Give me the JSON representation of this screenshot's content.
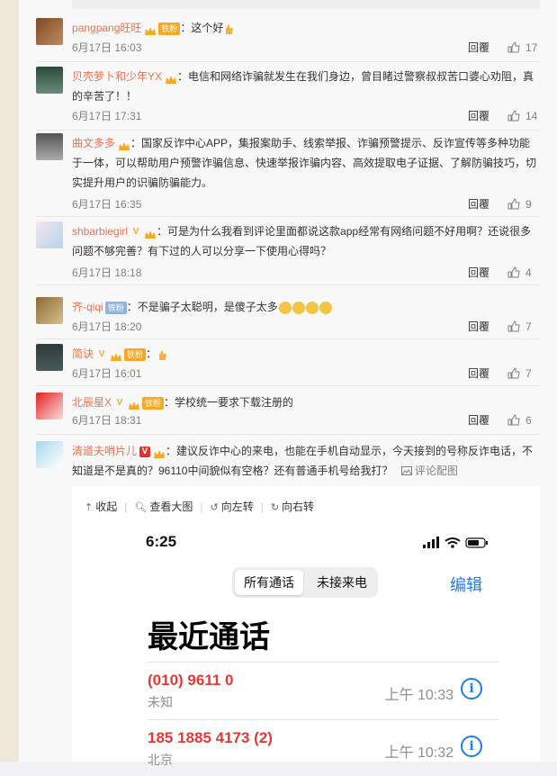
{
  "comments": [
    {
      "username": "pangpang旺旺",
      "badge": "铁粉",
      "content": "：这个好",
      "date": "6月17日 16:03",
      "reply_label": "回覆",
      "likes": "17"
    },
    {
      "username": "贝壳萝卜和少年YX",
      "badge": "",
      "content": "：电信和网络诈骗就发生在我们身边，曾目睹过警察叔叔苦口婆心劝阻，真的辛苦了！！",
      "date": "6月17日 17:31",
      "reply_label": "回覆",
      "likes": "14"
    },
    {
      "username": "曲文多多",
      "badge": "",
      "content": "：国家反诈中心APP，集报案助手、线索举报、诈骗预警提示、反诈宣传等多种功能于一体，可以帮助用户预警诈骗信息、快速举报诈骗内容、高效提取电子证据、了解防骗技巧，切实提升用户的识骗防骗能力。",
      "date": "6月17日 16:35",
      "reply_label": "回覆",
      "likes": "9"
    },
    {
      "username": "shbarbiegirl",
      "badge": "",
      "content": "：可是为什么我看到评论里面都说这款app经常有网络问题不好用啊？还说很多问题不够完善？有下过的人可以分享一下使用心得吗？",
      "date": "6月17日 18:18",
      "reply_label": "回覆",
      "likes": "4"
    },
    {
      "username": "齐-qiqi",
      "badge": "铁粉",
      "content": "：不是骗子太聪明，是傻子太多",
      "date": "6月17日 18:20",
      "reply_label": "回覆",
      "likes": "7"
    },
    {
      "username": "简诀",
      "badge": "铁粉",
      "content": "：",
      "date": "6月17日 16:01",
      "reply_label": "回覆",
      "likes": "7"
    },
    {
      "username": "北辰星X",
      "badge": "铁粉",
      "content": "：学校统一要求下载注册的",
      "date": "6月17日 18:31",
      "reply_label": "回覆",
      "likes": "6"
    },
    {
      "username": "清道夫哨片儿",
      "badge": "",
      "content": "：建议反诈中心的来电，也能在手机自动显示，今天接到的号称反诈电话，不知道是不是真的？96110中间貌似有空格？还有普通手机号给我打？",
      "date": "",
      "reply_label": "",
      "likes": "",
      "image_link": "评论配图"
    }
  ],
  "viewer": {
    "collapse": "收起",
    "view_large": "查看大图",
    "rotate_left": "向左转",
    "rotate_right": "向右转"
  },
  "phone": {
    "time": "6:25",
    "seg_all": "所有通话",
    "seg_missed": "未接来电",
    "edit": "编辑",
    "title": "最近通话",
    "calls": [
      {
        "number": "(010) 9611 0",
        "sub": "未知",
        "time": "上午 10:33"
      },
      {
        "number": "185 1885 4173 (2)",
        "sub": "北京",
        "time": "上午 10:32"
      }
    ]
  },
  "colors": {
    "username": "#eb7350",
    "missed_call": "#e53935",
    "ios_blue": "#1a7ef0"
  }
}
